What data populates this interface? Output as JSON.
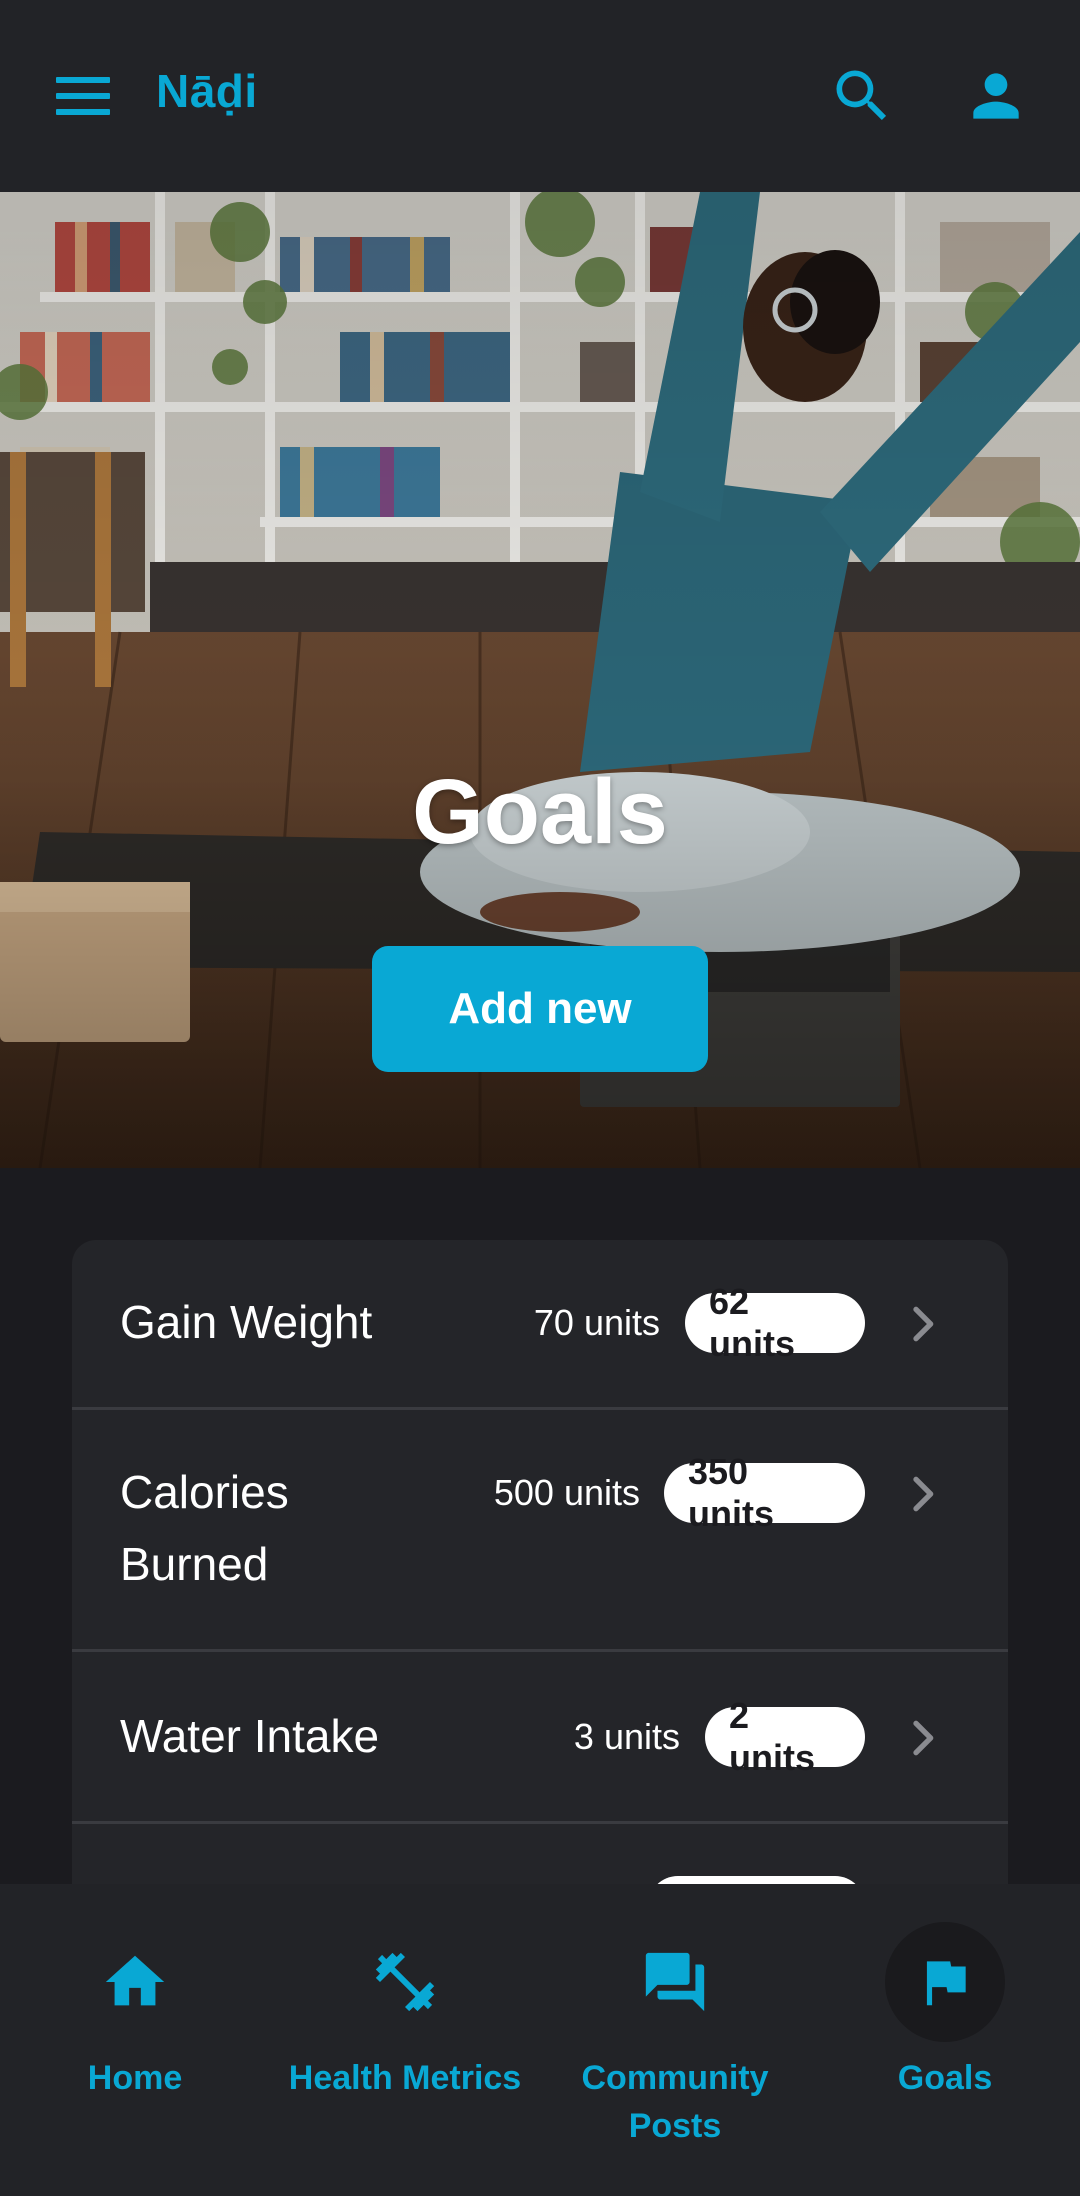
{
  "app": {
    "title": "Nāḍi",
    "accent_color": "#09a8d4",
    "background_color": "#1b1b1f"
  },
  "topbar": {
    "menu_icon": "menu-icon",
    "search_icon": "search-icon",
    "account_icon": "account-icon"
  },
  "hero": {
    "title": "Goals",
    "add_button_label": "Add new"
  },
  "goals": [
    {
      "name": "Gain Weight",
      "target": "70 units",
      "current": "62 units"
    },
    {
      "name": "Calories Burned",
      "target": "500 units",
      "current": "350 units"
    },
    {
      "name": "Water Intake",
      "target": "3 units",
      "current": "2 units"
    }
  ],
  "bottom_nav": {
    "items": [
      {
        "label": "Home",
        "icon": "home-icon",
        "active": false
      },
      {
        "label": "Health Metrics",
        "icon": "fitness-icon",
        "active": false
      },
      {
        "label": "Community Posts",
        "icon": "forum-icon",
        "active": false
      },
      {
        "label": "Goals",
        "icon": "flag-icon",
        "active": true
      }
    ]
  }
}
